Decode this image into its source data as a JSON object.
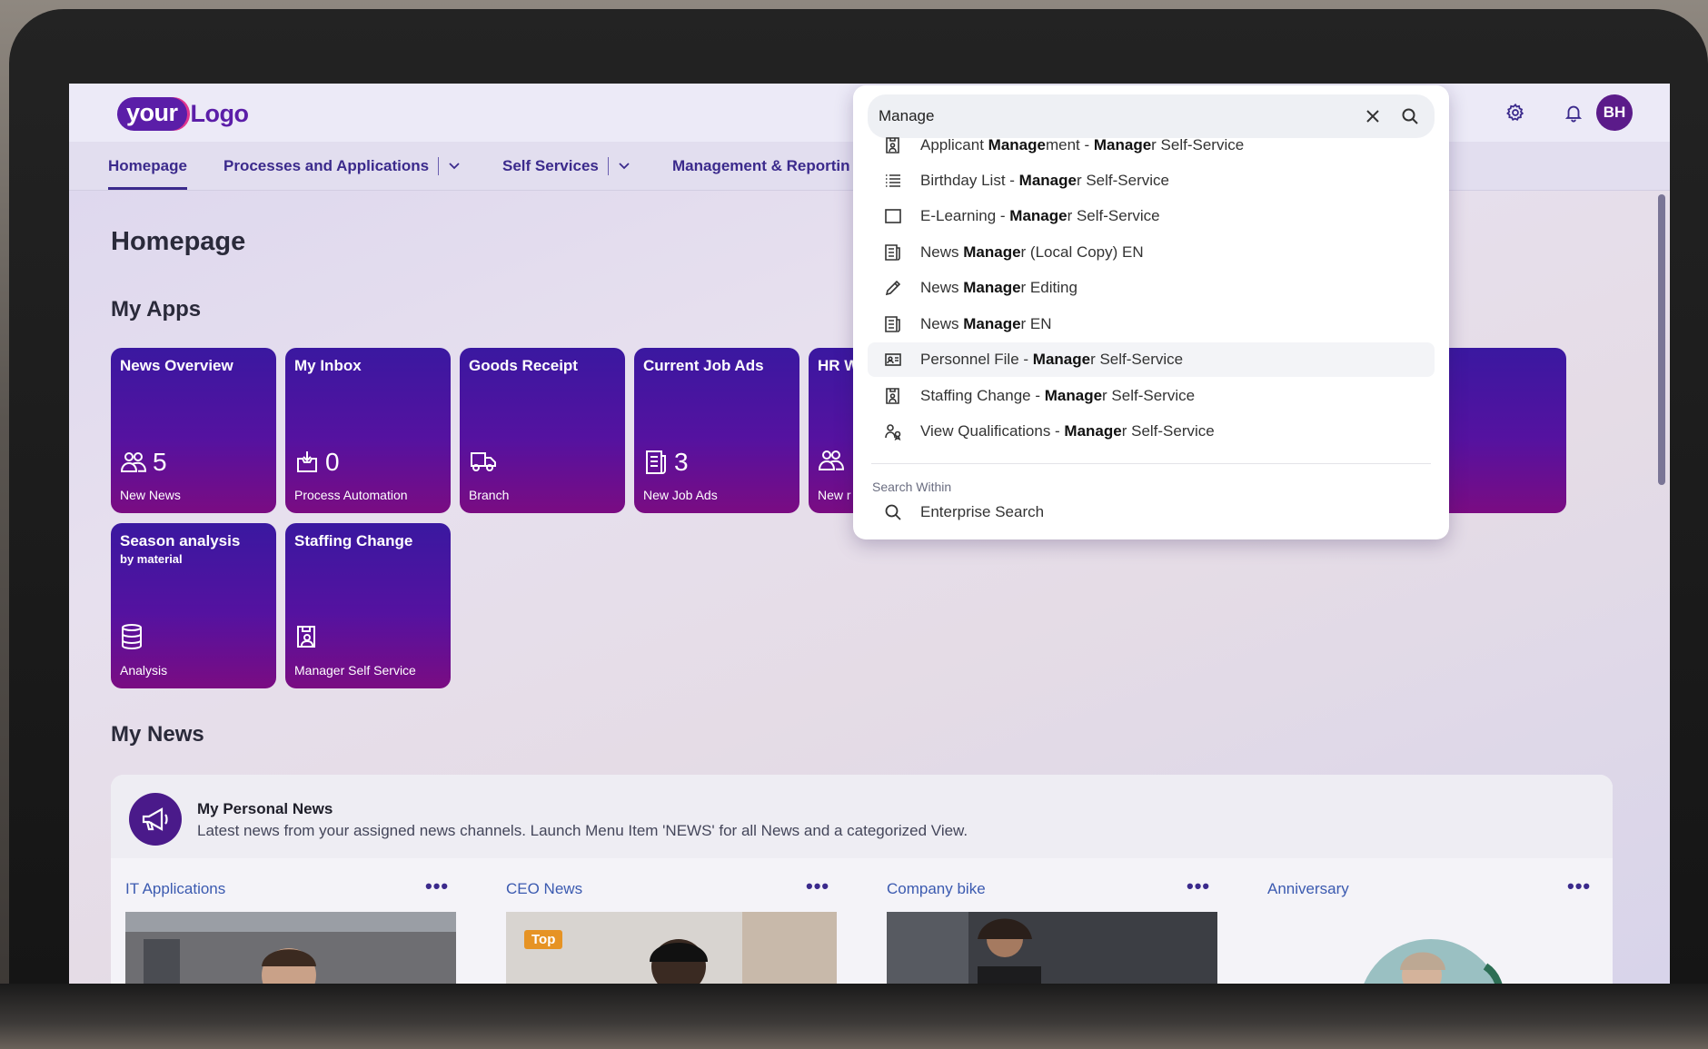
{
  "logo": {
    "part1": "your",
    "part2": "Logo"
  },
  "header": {
    "avatar_initials": "BH",
    "settings_icon": "gear-icon",
    "notifications_icon": "bell-icon"
  },
  "nav": {
    "items": [
      {
        "label": "Homepage",
        "active": true
      },
      {
        "label": "Processes and Applications",
        "has_menu": true
      },
      {
        "label": "Self Services",
        "has_menu": true
      },
      {
        "label": "Management & Reportin"
      }
    ]
  },
  "page": {
    "title": "Homepage",
    "apps_title": "My Apps",
    "news_title": "My News"
  },
  "tiles": [
    {
      "title": "News Overview",
      "subtitle": "",
      "kpi": "5",
      "icon": "group-icon",
      "footer": "New News"
    },
    {
      "title": "My Inbox",
      "subtitle": "",
      "kpi": "0",
      "icon": "inbox-icon",
      "footer": "Process Automation"
    },
    {
      "title": "Goods Receipt",
      "subtitle": "",
      "kpi": "",
      "icon": "truck-icon",
      "footer": "Branch"
    },
    {
      "title": "Current Job Ads",
      "subtitle": "",
      "kpi": "3",
      "icon": "document-icon",
      "footer": "New Job Ads"
    },
    {
      "title": "HR W",
      "subtitle": "",
      "kpi": "",
      "icon": "group-icon",
      "footer": "New r"
    },
    {
      "title": "Season analysis",
      "subtitle": "by material",
      "kpi": "",
      "icon": "database-icon",
      "footer": "Analysis"
    },
    {
      "title": "Staffing Change",
      "subtitle": "",
      "kpi": "",
      "icon": "badge-icon",
      "footer": "Manager Self Service"
    }
  ],
  "search": {
    "value": "Manage",
    "clear_icon": "close-icon",
    "search_icon": "search-icon",
    "suggestions": [
      {
        "pre": "Applicant ",
        "bold": "Manage",
        "post": "ment - ",
        "bold2": "Manage",
        "post2": "r Self-Service",
        "icon": "badge-icon"
      },
      {
        "pre": "Birthday List - ",
        "bold": "Manage",
        "post": "r Self-Service",
        "icon": "list-icon"
      },
      {
        "pre": "E-Learning - ",
        "bold": "Manage",
        "post": "r Self-Service",
        "icon": "square-icon"
      },
      {
        "pre": "News ",
        "bold": "Manage",
        "post": "r (Local Copy) EN",
        "icon": "document-icon"
      },
      {
        "pre": "News ",
        "bold": "Manage",
        "post": "r Editing",
        "icon": "edit-icon"
      },
      {
        "pre": "News ",
        "bold": "Manage",
        "post": "r EN",
        "icon": "document-icon"
      },
      {
        "pre": "Personnel File - ",
        "bold": "Manage",
        "post": "r Self-Service",
        "icon": "id-card-icon"
      },
      {
        "pre": "Staffing Change - ",
        "bold": "Manage",
        "post": "r Self-Service",
        "icon": "badge-icon"
      },
      {
        "pre": "View Qualifications - ",
        "bold": "Manage",
        "post": "r Self-Service",
        "icon": "qualification-icon"
      }
    ],
    "within_label": "Search Within",
    "enterprise": "Enterprise Search"
  },
  "news": {
    "card_title": "My Personal News",
    "card_desc": "Latest news from your assigned news channels. Launch Menu Item 'NEWS' for all News and a categorized View.",
    "channels": [
      {
        "name": "IT Applications",
        "badge": ""
      },
      {
        "name": "CEO News",
        "badge": "Top"
      },
      {
        "name": "Company bike",
        "badge": ""
      },
      {
        "name": "Anniversary",
        "badge": ""
      }
    ],
    "more_label": "•••"
  },
  "colors": {
    "brand": "#5b1ea8",
    "tile_top": "#3a18a0",
    "tile_bottom": "#7a0c82",
    "nav_text": "#3b2a8c"
  }
}
